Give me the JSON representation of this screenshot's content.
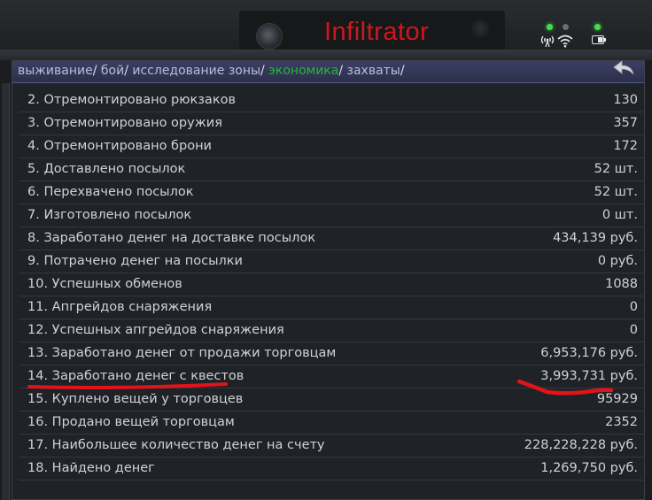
{
  "device": {
    "brand": "Infiltrator",
    "icons": [
      "camera-icon",
      "signal-icon",
      "wifi-icon",
      "battery-icon"
    ],
    "led_color": "#3fe04a",
    "brand_color": "#d0181c"
  },
  "tabs": [
    {
      "label": "выживание",
      "active": false
    },
    {
      "label": "бой",
      "active": false
    },
    {
      "label": "исследование зоны",
      "active": false
    },
    {
      "label": "экономика",
      "active": true
    },
    {
      "label": "захваты",
      "active": false
    }
  ],
  "tab_separator": "/",
  "active_tab_color": "#23b83a",
  "annotation_color": "#e0141a",
  "rows": [
    {
      "label": "2. Отремонтировано рюкзаков",
      "value": "130"
    },
    {
      "label": "3. Отремонтировано оружия",
      "value": "357"
    },
    {
      "label": "4. Отремонтировано брони",
      "value": "172"
    },
    {
      "label": "5. Доставлено посылок",
      "value": "52 шт."
    },
    {
      "label": "6. Перехвачено посылок",
      "value": "52 шт."
    },
    {
      "label": "7. Изготовлено посылок",
      "value": "0 шт."
    },
    {
      "label": "8. Заработано денег на доставке посылок",
      "value": "434,139 руб."
    },
    {
      "label": "9. Потрачено денег на посылки",
      "value": "0 руб."
    },
    {
      "label": "10. Успешных обменов",
      "value": "1088"
    },
    {
      "label": "11. Апгрейдов снаряжения",
      "value": "0"
    },
    {
      "label": "12. Успешных апгрейдов снаряжения",
      "value": "0"
    },
    {
      "label": "13. Заработано денег от продажи торговцам",
      "value": "6,953,176 руб."
    },
    {
      "label": "14. Заработано денег с квестов",
      "value": "3,993,731 руб."
    },
    {
      "label": "15. Куплено вещей у торговцев",
      "value": "95929"
    },
    {
      "label": "16. Продано вещей торговцам",
      "value": "2352"
    },
    {
      "label": "17. Наибольшее количество денег на счету",
      "value": "228,228,228 руб."
    },
    {
      "label": "18. Найдено денег",
      "value": "1,269,750 руб."
    }
  ]
}
